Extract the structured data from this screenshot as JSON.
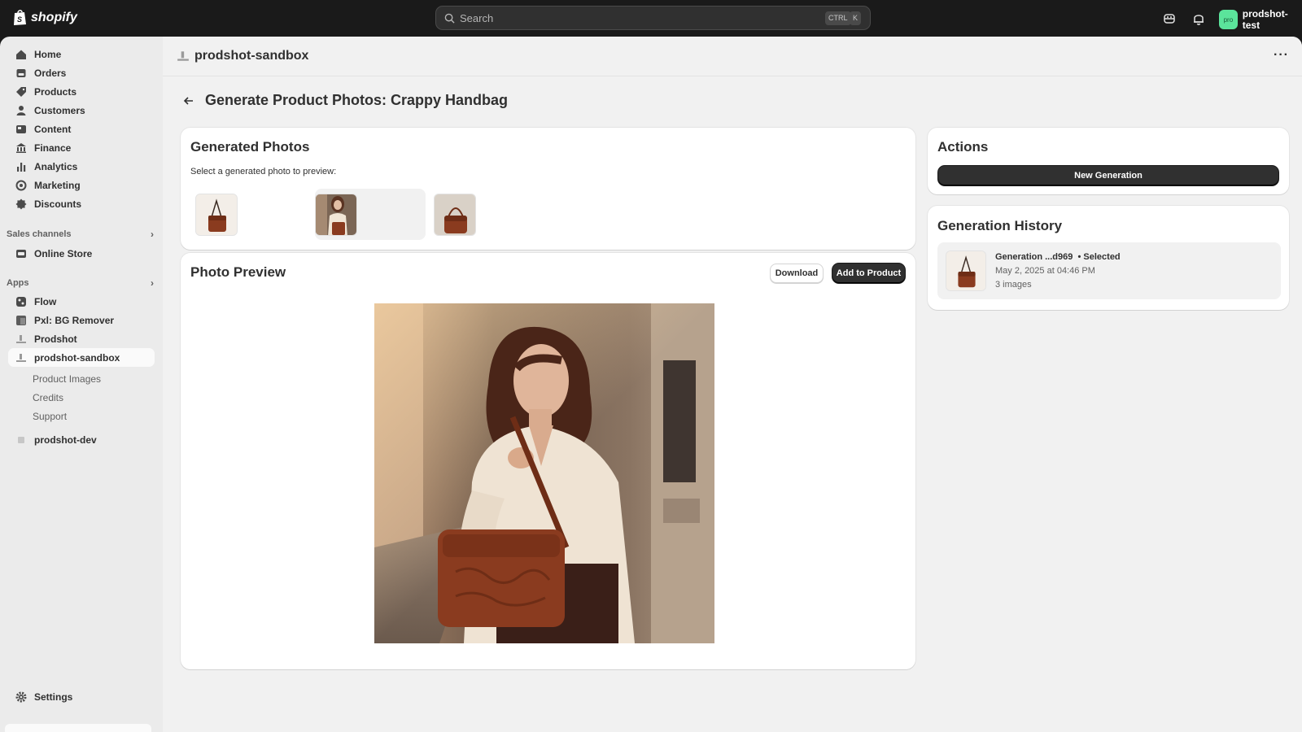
{
  "topbar": {
    "brand": "shopify",
    "search_placeholder": "Search",
    "kbd_ctrl": "CTRL",
    "kbd_k": "K",
    "avatar_initials": "pro",
    "account_name": "prodshot-test"
  },
  "sidebar": {
    "items": [
      {
        "label": "Home",
        "icon": "home-icon"
      },
      {
        "label": "Orders",
        "icon": "orders-icon"
      },
      {
        "label": "Products",
        "icon": "tag-icon"
      },
      {
        "label": "Customers",
        "icon": "person-icon"
      },
      {
        "label": "Content",
        "icon": "content-icon"
      },
      {
        "label": "Finance",
        "icon": "bank-icon"
      },
      {
        "label": "Analytics",
        "icon": "chart-icon"
      },
      {
        "label": "Marketing",
        "icon": "target-icon"
      },
      {
        "label": "Discounts",
        "icon": "discount-icon"
      }
    ],
    "sales_channels_label": "Sales channels",
    "online_store": "Online Store",
    "apps_label": "Apps",
    "apps": [
      "Flow",
      "Pxl: BG Remover",
      "Prodshot",
      "prodshot-sandbox"
    ],
    "app_subitems": [
      "Product Images",
      "Credits",
      "Support"
    ],
    "prodshot_dev": "prodshot-dev",
    "settings": "Settings"
  },
  "header": {
    "app_title": "prodshot-sandbox"
  },
  "page": {
    "title": "Generate Product Photos: Crappy Handbag"
  },
  "generated": {
    "title": "Generated Photos",
    "instruction": "Select a generated photo to preview:"
  },
  "preview": {
    "title": "Photo Preview",
    "download": "Download",
    "add_to_product": "Add to Product"
  },
  "actions": {
    "title": "Actions",
    "new_generation": "New Generation"
  },
  "history": {
    "title": "Generation History",
    "entry_title": "Generation ...d969",
    "entry_status": "• Selected",
    "entry_date": "May 2, 2025 at 04:46 PM",
    "entry_count": "3 images"
  },
  "colors": {
    "accent_dark": "#303030",
    "avatar_green": "#5be49b",
    "bag_brown": "#8a3b1f"
  }
}
